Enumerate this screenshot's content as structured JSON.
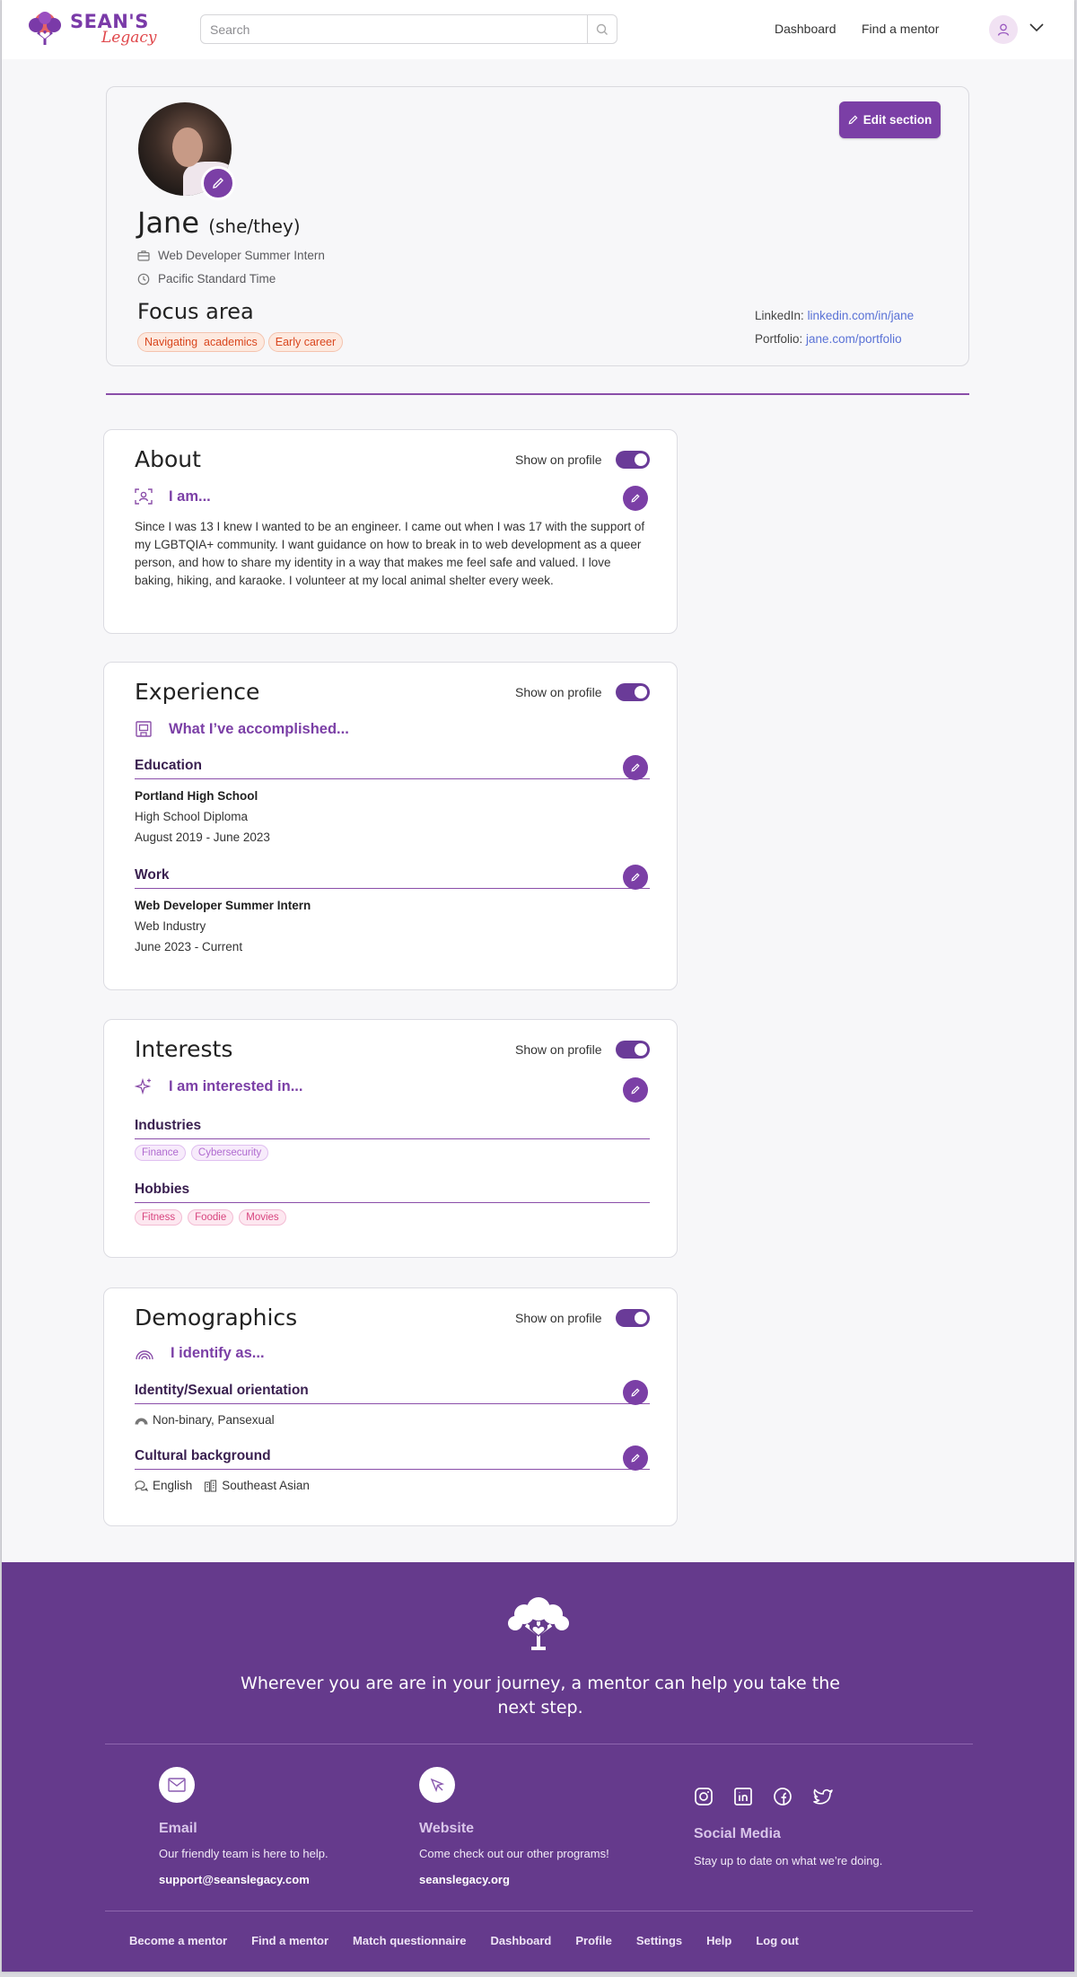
{
  "brand": {
    "name_line1": "SEAN'S",
    "name_line2": "Legacy",
    "colors": {
      "primary": "#7b3fa6",
      "footer": "#653a8c",
      "accent_orange": "#d9461e",
      "link": "#5a72d6"
    }
  },
  "header": {
    "search_placeholder": "Search",
    "nav": [
      "Dashboard",
      "Find a mentor"
    ],
    "icons": [
      "search-icon",
      "user-icon",
      "chevron-down-icon"
    ]
  },
  "profile": {
    "name": "Jane",
    "pronouns": "(she/they)",
    "role": "Web Developer Summer Intern",
    "timezone": "Pacific Standard Time",
    "edit_button": "Edit section",
    "focus_title": "Focus area",
    "focus_tags": [
      "Navigating  academics",
      "Early career"
    ],
    "links": [
      {
        "label": "LinkedIn:",
        "value": "linkedin.com/in/jane"
      },
      {
        "label": "Portfolio:",
        "value": "jane.com/portfolio"
      }
    ]
  },
  "common": {
    "show_on_profile": "Show on profile"
  },
  "about": {
    "title": "About",
    "subtitle": "I am...",
    "text": "Since I was 13 I knew I wanted to be an engineer. I came out when I was 17 with the support of my LGBTQIA+ community. I want guidance on how to break in to web development as a queer person, and how to share my identity in a way that makes me feel safe and valued. I love baking, hiking, and karaoke. I volunteer at my local animal shelter every week."
  },
  "experience": {
    "title": "Experience",
    "subtitle": "What I’ve accomplished...",
    "education": {
      "heading": "Education",
      "school": "Portland High School",
      "degree": "High School Diploma",
      "dates": "August 2019 - June 2023"
    },
    "work": {
      "heading": "Work",
      "role": "Web Developer Summer Intern",
      "industry": "Web Industry",
      "dates": "June 2023 - Current"
    }
  },
  "interests": {
    "title": "Interests",
    "subtitle": "I am interested in...",
    "industries_heading": "Industries",
    "industries": [
      "Finance",
      "Cybersecurity"
    ],
    "hobbies_heading": "Hobbies",
    "hobbies": [
      "Fitness",
      "Foodie",
      "Movies"
    ]
  },
  "demographics": {
    "title": "Demographics",
    "subtitle": "I identify as...",
    "identity_heading": "Identity/Sexual orientation",
    "identity_value": "Non-binary, Pansexual",
    "culture_heading": "Cultural background",
    "language": "English",
    "ethnicity": "Southeast Asian"
  },
  "footer": {
    "tagline": "Wherever you are are in your journey, a mentor can help you take the next step.",
    "email": {
      "heading": "Email",
      "desc": "Our friendly team is here to help.",
      "value": "support@seanslegacy.com"
    },
    "website": {
      "heading": "Website",
      "desc": "Come check out our other programs!",
      "value": "seanslegacy.org"
    },
    "social": {
      "heading": "Social Media",
      "desc": "Stay up to date on what we’re doing.",
      "icons": [
        "instagram-icon",
        "linkedin-icon",
        "facebook-icon",
        "twitter-icon"
      ]
    },
    "nav": [
      "Become a mentor",
      "Find a mentor",
      "Match questionnaire",
      "Dashboard",
      "Profile",
      "Settings",
      "Help",
      "Log out"
    ]
  }
}
